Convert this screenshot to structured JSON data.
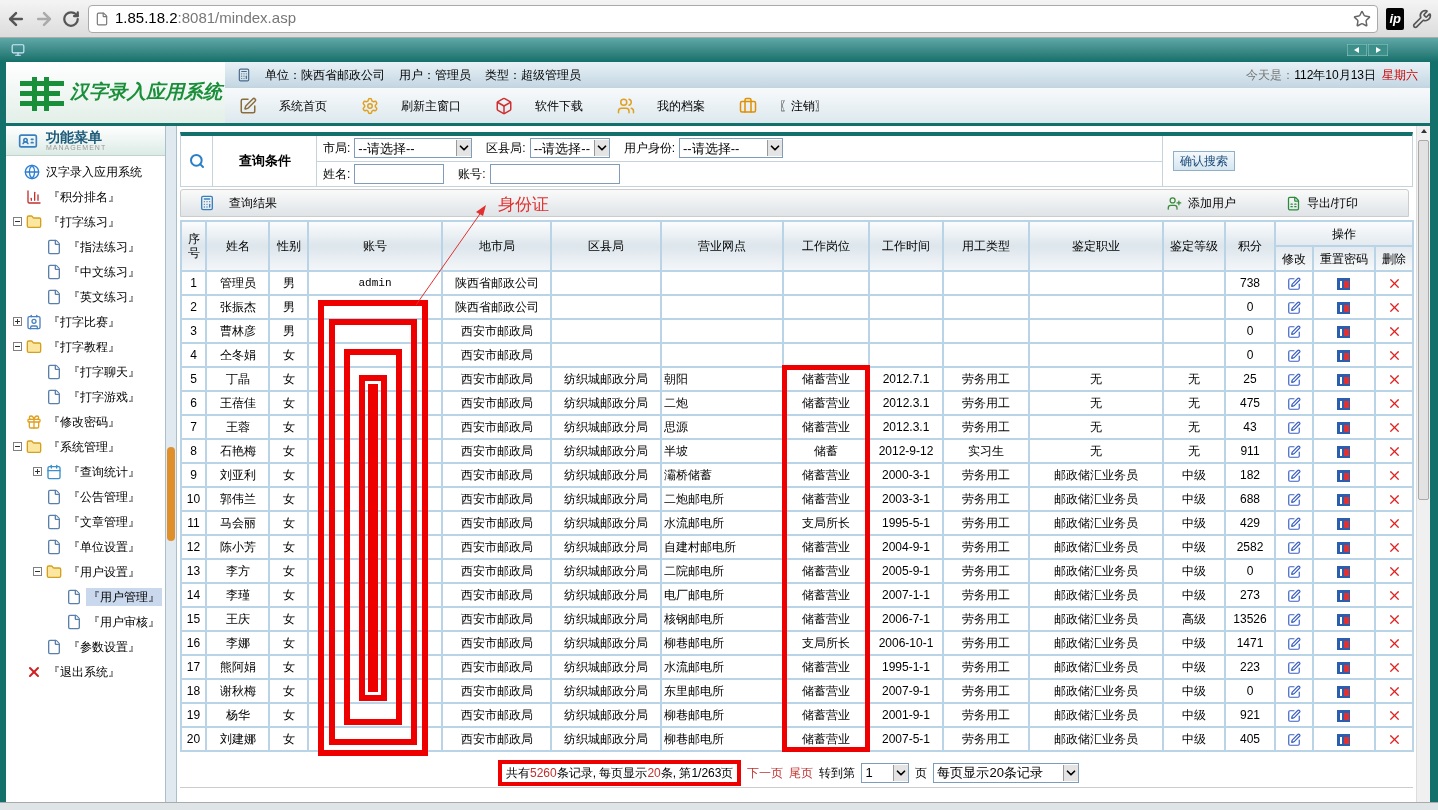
{
  "browser": {
    "url_host": "1.85.18.2",
    "url_path": ":8081/mindex.asp",
    "extension_label": "ip"
  },
  "header": {
    "app_title": "汉字录入应用系统",
    "info": [
      "单位：陕西省邮政公司",
      "用户：管理员",
      "类型：超级管理员"
    ],
    "date_prefix": "今天是：",
    "date": "112年10月13日",
    "weekday": "星期六",
    "nav": [
      {
        "label": "系统首页",
        "kind": "home"
      },
      {
        "label": "刷新主窗口",
        "kind": "refresh"
      },
      {
        "label": "软件下载",
        "kind": "download"
      },
      {
        "label": "我的档案",
        "kind": "profile"
      },
      {
        "label": "〖注销〗",
        "kind": "logout"
      }
    ]
  },
  "sidebar": {
    "title": "功能菜单",
    "subtitle": "MANAGEMENT",
    "tree": [
      {
        "label": "汉字录入应用系统",
        "kind": "globe",
        "selected": false,
        "children": [
          {
            "label": "『积分排名』",
            "kind": "chart",
            "selected": false
          },
          {
            "label": "『打字练习』",
            "kind": "folder",
            "selected": false,
            "expanded": true,
            "children": [
              {
                "label": "『指法练习』",
                "kind": "page",
                "selected": false
              },
              {
                "label": "『中文练习』",
                "kind": "page",
                "selected": false
              },
              {
                "label": "『英文练习』",
                "kind": "page",
                "selected": false
              }
            ]
          },
          {
            "label": "『打字比赛』",
            "kind": "people",
            "selected": false,
            "expanded": false
          },
          {
            "label": "『打字教程』",
            "kind": "folder",
            "selected": false,
            "expanded": true,
            "children": [
              {
                "label": "『打字聊天』",
                "kind": "page",
                "selected": false
              },
              {
                "label": "『打字游戏』",
                "kind": "page",
                "selected": false
              }
            ]
          },
          {
            "label": "『修改密码』",
            "kind": "gift",
            "selected": false
          },
          {
            "label": "『系统管理』",
            "kind": "folder",
            "selected": false,
            "expanded": true,
            "children": [
              {
                "label": "『查询统计』",
                "kind": "calendar",
                "selected": false,
                "expanded": false
              },
              {
                "label": "『公告管理』",
                "kind": "page",
                "selected": false
              },
              {
                "label": "『文章管理』",
                "kind": "page",
                "selected": false
              },
              {
                "label": "『单位设置』",
                "kind": "page",
                "selected": false
              },
              {
                "label": "『用户设置』",
                "kind": "folder",
                "selected": false,
                "expanded": true,
                "children": [
                  {
                    "label": "『用户管理』",
                    "kind": "page",
                    "selected": true
                  },
                  {
                    "label": "『用户审核』",
                    "kind": "page",
                    "selected": false
                  }
                ]
              },
              {
                "label": "『参数设置』",
                "kind": "page",
                "selected": false
              }
            ]
          },
          {
            "label": "『退出系统』",
            "kind": "exit",
            "selected": false
          }
        ]
      }
    ]
  },
  "query": {
    "title": "查询条件",
    "rows": [
      [
        {
          "label": "市局:",
          "kind": "select",
          "value": "--请选择--"
        },
        {
          "label": "区县局:",
          "kind": "select",
          "value": "--请选择--"
        },
        {
          "label": "用户身份:",
          "kind": "select",
          "value": "--请选择--"
        }
      ],
      [
        {
          "label": "姓名:",
          "kind": "input"
        },
        {
          "label": "账号:",
          "kind": "input"
        }
      ]
    ],
    "button": "确认搜索"
  },
  "results": {
    "title": "查询结果",
    "annotation": "身份证",
    "actions": [
      {
        "label": "添加用户",
        "kind": "add"
      },
      {
        "label": "导出/打印",
        "kind": "export"
      }
    ]
  },
  "table": {
    "columns": [
      "序号",
      "姓名",
      "性别",
      "账号",
      "地市局",
      "区县局",
      "营业网点",
      "工作岗位",
      "工作时间",
      "用工类型",
      "鉴定职业",
      "鉴定等级",
      "积分"
    ],
    "action_group": "操作",
    "action_columns": [
      "修改",
      "重置密码",
      "删除"
    ],
    "rows": [
      {
        "no": "1",
        "name": "管理员",
        "sex": "男",
        "account": "admin",
        "city": "陕西省邮政公司",
        "score": "738"
      },
      {
        "no": "2",
        "name": "张振杰",
        "sex": "男",
        "city": "陕西省邮政公司",
        "score": "0"
      },
      {
        "no": "3",
        "name": "曹林彦",
        "sex": "男",
        "city": "西安市邮政局",
        "score": "0"
      },
      {
        "no": "4",
        "name": "仝冬娟",
        "sex": "女",
        "city": "西安市邮政局",
        "score": "0"
      },
      {
        "no": "5",
        "name": "丁晶",
        "sex": "女",
        "city": "西安市邮政局",
        "district": "纺织城邮政分局",
        "outlet": "朝阳",
        "post": "储蓄营业",
        "start": "2012.7.1",
        "type": "劳务用工",
        "job": "无",
        "grade": "无",
        "score": "25"
      },
      {
        "no": "6",
        "name": "王蓓佳",
        "sex": "女",
        "city": "西安市邮政局",
        "district": "纺织城邮政分局",
        "outlet": "二炮",
        "post": "储蓄营业",
        "start": "2012.3.1",
        "type": "劳务用工",
        "job": "无",
        "grade": "无",
        "score": "475"
      },
      {
        "no": "7",
        "name": "王蓉",
        "sex": "女",
        "city": "西安市邮政局",
        "district": "纺织城邮政分局",
        "outlet": "思源",
        "post": "储蓄营业",
        "start": "2012.3.1",
        "type": "劳务用工",
        "job": "无",
        "grade": "无",
        "score": "43"
      },
      {
        "no": "8",
        "name": "石艳梅",
        "sex": "女",
        "city": "西安市邮政局",
        "district": "纺织城邮政分局",
        "outlet": "半坡",
        "post": "储蓄",
        "start": "2012-9-12",
        "type": "实习生",
        "job": "无",
        "grade": "无",
        "score": "911"
      },
      {
        "no": "9",
        "name": "刘亚利",
        "sex": "女",
        "city": "西安市邮政局",
        "district": "纺织城邮政分局",
        "outlet": "灞桥储蓄",
        "post": "储蓄营业",
        "start": "2000-3-1",
        "type": "劳务用工",
        "job": "邮政储汇业务员",
        "grade": "中级",
        "score": "182"
      },
      {
        "no": "10",
        "name": "郭伟兰",
        "sex": "女",
        "city": "西安市邮政局",
        "district": "纺织城邮政分局",
        "outlet": "二炮邮电所",
        "post": "储蓄营业",
        "start": "2003-3-1",
        "type": "劳务用工",
        "job": "邮政储汇业务员",
        "grade": "中级",
        "score": "688"
      },
      {
        "no": "11",
        "name": "马会丽",
        "sex": "女",
        "city": "西安市邮政局",
        "district": "纺织城邮政分局",
        "outlet": "水流邮电所",
        "post": "支局所长",
        "start": "1995-5-1",
        "type": "劳务用工",
        "job": "邮政储汇业务员",
        "grade": "中级",
        "score": "429"
      },
      {
        "no": "12",
        "name": "陈小芳",
        "sex": "女",
        "city": "西安市邮政局",
        "district": "纺织城邮政分局",
        "outlet": "自建村邮电所",
        "post": "储蓄营业",
        "start": "2004-9-1",
        "type": "劳务用工",
        "job": "邮政储汇业务员",
        "grade": "中级",
        "score": "2582"
      },
      {
        "no": "13",
        "name": "李方",
        "sex": "女",
        "city": "西安市邮政局",
        "district": "纺织城邮政分局",
        "outlet": "二院邮电所",
        "post": "储蓄营业",
        "start": "2005-9-1",
        "type": "劳务用工",
        "job": "邮政储汇业务员",
        "grade": "中级",
        "score": "0"
      },
      {
        "no": "14",
        "name": "李瑾",
        "sex": "女",
        "city": "西安市邮政局",
        "district": "纺织城邮政分局",
        "outlet": "电厂邮电所",
        "post": "储蓄营业",
        "start": "2007-1-1",
        "type": "劳务用工",
        "job": "邮政储汇业务员",
        "grade": "中级",
        "score": "273"
      },
      {
        "no": "15",
        "name": "王庆",
        "sex": "女",
        "city": "西安市邮政局",
        "district": "纺织城邮政分局",
        "outlet": "核钢邮电所",
        "post": "储蓄营业",
        "start": "2006-7-1",
        "type": "劳务用工",
        "job": "邮政储汇业务员",
        "grade": "高级",
        "score": "13526"
      },
      {
        "no": "16",
        "name": "李娜",
        "sex": "女",
        "city": "西安市邮政局",
        "district": "纺织城邮政分局",
        "outlet": "柳巷邮电所",
        "post": "支局所长",
        "start": "2006-10-1",
        "type": "劳务用工",
        "job": "邮政储汇业务员",
        "grade": "中级",
        "score": "1471"
      },
      {
        "no": "17",
        "name": "熊阿娟",
        "sex": "女",
        "city": "西安市邮政局",
        "district": "纺织城邮政分局",
        "outlet": "水流邮电所",
        "post": "储蓄营业",
        "start": "1995-1-1",
        "type": "劳务用工",
        "job": "邮政储汇业务员",
        "grade": "中级",
        "score": "223"
      },
      {
        "no": "18",
        "name": "谢秋梅",
        "sex": "女",
        "city": "西安市邮政局",
        "district": "纺织城邮政分局",
        "outlet": "东里邮电所",
        "post": "储蓄营业",
        "start": "2007-9-1",
        "type": "劳务用工",
        "job": "邮政储汇业务员",
        "grade": "中级",
        "score": "0"
      },
      {
        "no": "19",
        "name": "杨华",
        "sex": "女",
        "city": "西安市邮政局",
        "district": "纺织城邮政分局",
        "outlet": "柳巷邮电所",
        "post": "储蓄营业",
        "start": "2001-9-1",
        "type": "劳务用工",
        "job": "邮政储汇业务员",
        "grade": "中级",
        "score": "921"
      },
      {
        "no": "20",
        "name": "刘建娜",
        "sex": "女",
        "city": "西安市邮政局",
        "district": "纺织城邮政分局",
        "outlet": "柳巷邮电所",
        "post": "储蓄营业",
        "start": "2007-5-1",
        "type": "劳务用工",
        "job": "邮政储汇业务员",
        "grade": "中级",
        "score": "405"
      }
    ]
  },
  "pagination": {
    "summary": [
      {
        "text": "共有",
        "kind": "plain"
      },
      {
        "text": "5260",
        "kind": "number"
      },
      {
        "text": "条记录, 每页显示",
        "kind": "plain"
      },
      {
        "text": "20",
        "kind": "number"
      },
      {
        "text": "条, 第1/263页",
        "kind": "plain"
      }
    ],
    "links": [
      "下一页",
      "尾页"
    ],
    "goto_label": "转到第",
    "page": "1",
    "page_suffix": "页",
    "page_size": "每页显示20条记录"
  }
}
